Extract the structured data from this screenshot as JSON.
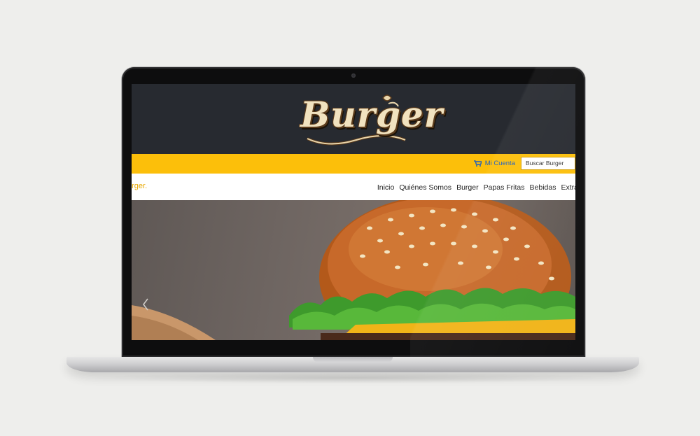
{
  "site": {
    "logo_text": "Burger",
    "account_label": "Mi Cuenta",
    "search_placeholder": "Buscar Burger",
    "brand_partial": "urger.",
    "menu": [
      "Inicio",
      "Quiénes Somos",
      "Burger",
      "Papas Fritas",
      "Bebidas",
      "Extra"
    ]
  },
  "colors": {
    "header_bg": "#272a30",
    "accent_yellow": "#fcbf0a",
    "link_blue": "#1f5fbf"
  },
  "icons": {
    "cart": "cart-icon",
    "carousel_prev": "chevron-left-icon"
  }
}
